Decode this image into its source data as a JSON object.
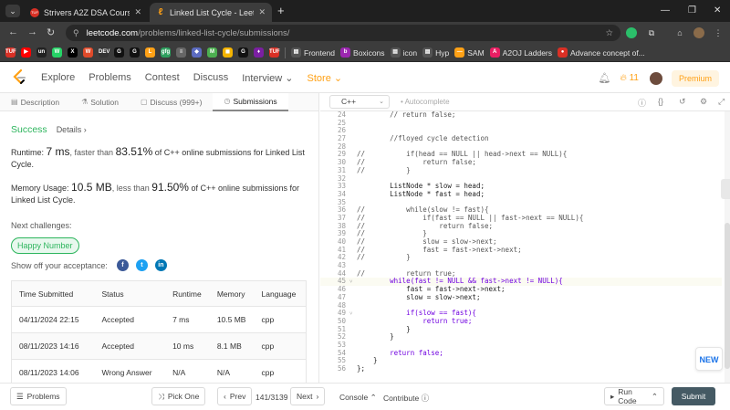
{
  "browser": {
    "tabs": [
      {
        "title": "Strivers A2Z DSA Course/Sheet",
        "favicon": "TUF",
        "active": false
      },
      {
        "title": "Linked List Cycle - LeetCode",
        "favicon": "leetcode",
        "active": true
      }
    ],
    "new_tab": "+",
    "url_host": "leetcode.com",
    "url_path": "/problems/linked-list-cycle/submissions/",
    "bookmarks": [
      {
        "label": "",
        "color": "#d93025",
        "glyph": "TUF"
      },
      {
        "label": "",
        "color": "#ff0000",
        "glyph": "▶"
      },
      {
        "label": "",
        "color": "#222222",
        "glyph": "un"
      },
      {
        "label": "",
        "color": "#25d366",
        "glyph": "W"
      },
      {
        "label": "",
        "color": "#000000",
        "glyph": "X"
      },
      {
        "label": "",
        "color": "#e04a2a",
        "glyph": "W"
      },
      {
        "label": "",
        "color": "#333333",
        "glyph": "DEV"
      },
      {
        "label": "",
        "color": "#111111",
        "glyph": "G"
      },
      {
        "label": "",
        "color": "#111111",
        "glyph": "G"
      },
      {
        "label": "",
        "color": "#ffa116",
        "glyph": "L"
      },
      {
        "label": "",
        "color": "#2d9f5e",
        "glyph": "gfg"
      },
      {
        "label": "",
        "color": "#666666",
        "glyph": "≡"
      },
      {
        "label": "",
        "color": "#5c6bc0",
        "glyph": "◆"
      },
      {
        "label": "",
        "color": "#4caf50",
        "glyph": "M"
      },
      {
        "label": "",
        "color": "#f4b400",
        "glyph": "◼"
      },
      {
        "label": "",
        "color": "#111111",
        "glyph": "G"
      },
      {
        "label": "",
        "color": "#7b1fa2",
        "glyph": "♦"
      },
      {
        "label": "",
        "color": "#d93025",
        "glyph": "TUF"
      },
      {
        "label": "Frontend",
        "color": "#555555",
        "glyph": "▤"
      },
      {
        "label": "Boxicons",
        "color": "#9c27b0",
        "glyph": "b"
      },
      {
        "label": "icon",
        "color": "#555555",
        "glyph": "▤"
      },
      {
        "label": "Hyp",
        "color": "#555555",
        "glyph": "▤"
      },
      {
        "label": "SAM",
        "color": "#ffa116",
        "glyph": "—"
      },
      {
        "label": "A2OJ Ladders",
        "color": "#e91e63",
        "glyph": "A"
      },
      {
        "label": "Advance concept of...",
        "color": "#d93025",
        "glyph": "●"
      }
    ]
  },
  "nav": {
    "items": [
      "Explore",
      "Problems",
      "Contest",
      "Discuss",
      "Interview",
      "Store"
    ],
    "streak": "11",
    "premium": "Premium"
  },
  "left_tabs": [
    {
      "label": "Description",
      "icon": "document-icon"
    },
    {
      "label": "Solution",
      "icon": "flask-icon"
    },
    {
      "label": "Discuss (999+)",
      "icon": "chat-icon"
    },
    {
      "label": "Submissions",
      "icon": "clock-icon"
    }
  ],
  "result": {
    "status": "Success",
    "details": "Details",
    "runtime_prefix": "Runtime: ",
    "runtime_value": "7 ms",
    "runtime_mid": ", faster than ",
    "runtime_pct": "83.51%",
    "runtime_suffix": " of C++ online submissions for Linked List Cycle.",
    "memory_prefix": "Memory Usage: ",
    "memory_value": "10.5 MB",
    "memory_mid": ", less than ",
    "memory_pct": "91.50%",
    "memory_suffix": " of C++ online submissions for Linked List Cycle.",
    "next_challenges": "Next challenges:",
    "challenge": "Happy Number",
    "share_label": "Show off your acceptance:"
  },
  "table": {
    "headers": [
      "Time Submitted",
      "Status",
      "Runtime",
      "Memory",
      "Language"
    ],
    "rows": [
      [
        "04/11/2024 22:15",
        "Accepted",
        "7 ms",
        "10.5 MB",
        "cpp"
      ],
      [
        "08/11/2023 14:16",
        "Accepted",
        "10 ms",
        "8.1 MB",
        "cpp"
      ],
      [
        "08/11/2023 14:06",
        "Wrong Answer",
        "N/A",
        "N/A",
        "cpp"
      ]
    ]
  },
  "editor": {
    "language": "C++",
    "autocomplete": "Autocomplete",
    "lines": [
      {
        "n": 24,
        "code": "        // return false;",
        "type": "cm"
      },
      {
        "n": 25,
        "code": "",
        "type": "tx"
      },
      {
        "n": 26,
        "code": "",
        "type": "tx"
      },
      {
        "n": 27,
        "code": "        //floyed cycle detection",
        "type": "cm"
      },
      {
        "n": 28,
        "code": "",
        "type": "tx"
      },
      {
        "n": 29,
        "code": "//          if(head == NULL || head->next == NULL){",
        "type": "cm"
      },
      {
        "n": 30,
        "code": "//              return false;",
        "type": "cm"
      },
      {
        "n": 31,
        "code": "//          }",
        "type": "cm"
      },
      {
        "n": 32,
        "code": "",
        "type": "tx"
      },
      {
        "n": 33,
        "code": "        ListNode * slow = head;",
        "type": "tx"
      },
      {
        "n": 34,
        "code": "        ListNode * fast = head;",
        "type": "tx"
      },
      {
        "n": 35,
        "code": "",
        "type": "tx"
      },
      {
        "n": 36,
        "code": "//          while(slow != fast){",
        "type": "cm"
      },
      {
        "n": 37,
        "code": "//              if(fast == NULL || fast->next == NULL){",
        "type": "cm"
      },
      {
        "n": 38,
        "code": "//                  return false;",
        "type": "cm"
      },
      {
        "n": 39,
        "code": "//              }",
        "type": "cm"
      },
      {
        "n": 40,
        "code": "//              slow = slow->next;",
        "type": "cm"
      },
      {
        "n": 41,
        "code": "//              fast = fast->next->next;",
        "type": "cm"
      },
      {
        "n": 42,
        "code": "//          }",
        "type": "cm"
      },
      {
        "n": 43,
        "code": "",
        "type": "tx"
      },
      {
        "n": 44,
        "code": "//          return true;",
        "type": "cm"
      },
      {
        "n": 45,
        "code": "        while(fast != NULL && fast->next != NULL){",
        "type": "kw",
        "fold": true,
        "hl": true
      },
      {
        "n": 46,
        "code": "            fast = fast->next->next;",
        "type": "tx"
      },
      {
        "n": 47,
        "code": "            slow = slow->next;",
        "type": "tx"
      },
      {
        "n": 48,
        "code": "",
        "type": "tx"
      },
      {
        "n": 49,
        "code": "            if(slow == fast){",
        "type": "kw",
        "fold": true
      },
      {
        "n": 50,
        "code": "                return true;",
        "type": "kw"
      },
      {
        "n": 51,
        "code": "            }",
        "type": "tx"
      },
      {
        "n": 52,
        "code": "        }",
        "type": "tx"
      },
      {
        "n": 53,
        "code": "",
        "type": "tx"
      },
      {
        "n": 54,
        "code": "        return false;",
        "type": "kw"
      },
      {
        "n": 55,
        "code": "    }",
        "type": "tx"
      },
      {
        "n": 56,
        "code": "};",
        "type": "tx"
      }
    ]
  },
  "new_badge": "NEW",
  "bottom": {
    "problems": "Problems",
    "pick_one": "Pick One",
    "prev": "Prev",
    "page": "141/3139",
    "next": "Next",
    "console": "Console",
    "contribute": "Contribute",
    "run_code": "Run Code",
    "submit": "Submit"
  },
  "colors": {
    "accent": "#ffa116",
    "success": "#2db55d",
    "error": "#ef4743",
    "submit": "#455a64"
  }
}
